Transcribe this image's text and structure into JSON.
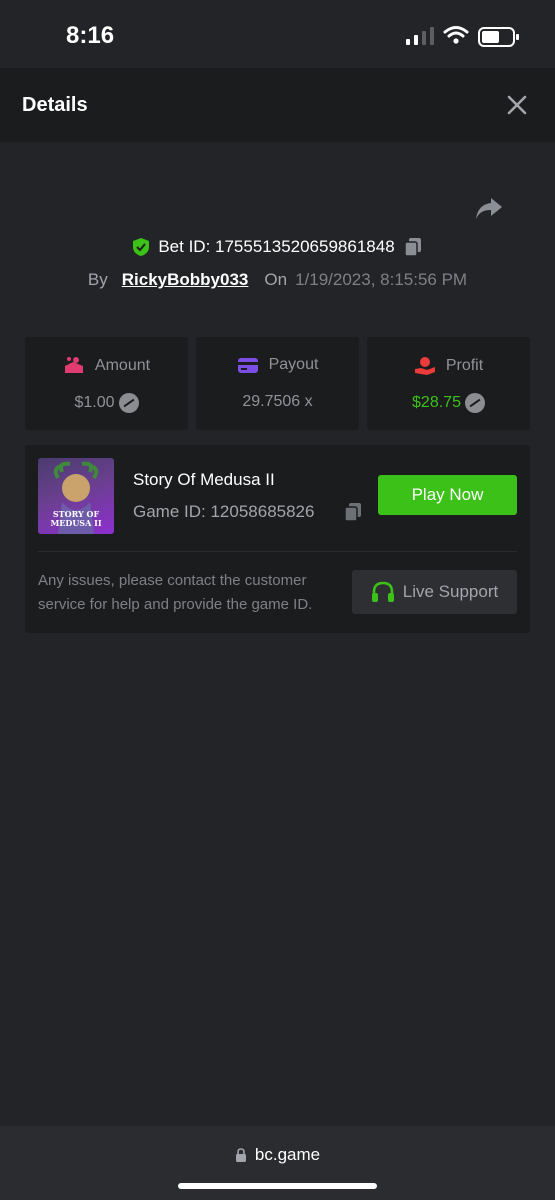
{
  "status_bar": {
    "time": "8:16"
  },
  "header": {
    "title": "Details"
  },
  "bet": {
    "bet_id_label": "Bet ID: 1755513520659861848",
    "by_label": "By",
    "username": "RickyBobby033",
    "on_label": "On",
    "datetime": "1/19/2023, 8:15:56 PM"
  },
  "stats": [
    {
      "label": "Amount",
      "value": "$1.00",
      "icon": "amount-icon",
      "color": "#e03c72"
    },
    {
      "label": "Payout",
      "value": "29.7506 x",
      "icon": "payout-icon",
      "color": "#7c4ee6"
    },
    {
      "label": "Profit",
      "value": "$28.75",
      "icon": "profit-icon",
      "color": "#ed3b3b"
    }
  ],
  "game": {
    "name": "Story Of Medusa II",
    "game_id_label": "Game ID: 12058685826",
    "thumbnail_text": "STORY OF MEDUSA II",
    "play_label": "Play Now",
    "support_text": "Any issues, please contact the customer service for help and provide the game ID.",
    "support_label": "Live Support"
  },
  "browser": {
    "url": "bc.game"
  },
  "colors": {
    "accent_green": "#3bc117",
    "background": "#232427",
    "card": "#1b1c1e"
  }
}
